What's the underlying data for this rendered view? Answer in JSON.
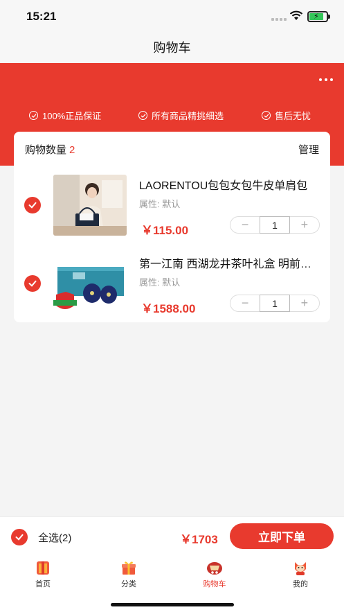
{
  "status_bar": {
    "time": "15:21"
  },
  "nav": {
    "title": "购物车"
  },
  "banner": {
    "guarantees": [
      "100%正品保证",
      "所有商品精挑细选",
      "售后无忧"
    ]
  },
  "cart": {
    "count_label": "购物数量",
    "count": "2",
    "manage_label": "管理",
    "items": [
      {
        "title": "LAORENTOU包包女包牛皮单肩包",
        "attr": "属性:  默认",
        "price": "￥115.00",
        "quantity": "1"
      },
      {
        "title": "第一江南 西湖龙井茶叶礼盒 明前特级",
        "attr": "属性:  默认",
        "price": "￥1588.00",
        "quantity": "1"
      }
    ],
    "stepper_minus": "−",
    "stepper_plus": "+"
  },
  "bottom": {
    "select_all_label": "全选(2)",
    "total": "￥1703",
    "order_button": "立即下单"
  },
  "tabs": [
    {
      "label": "首页",
      "icon": "home-icon",
      "active": false
    },
    {
      "label": "分类",
      "icon": "gift-icon",
      "active": false
    },
    {
      "label": "购物车",
      "icon": "cart-icon",
      "active": true
    },
    {
      "label": "我的",
      "icon": "profile-icon",
      "active": false
    }
  ],
  "colors": {
    "accent": "#e83a2e",
    "background": "#f4f4f4"
  }
}
